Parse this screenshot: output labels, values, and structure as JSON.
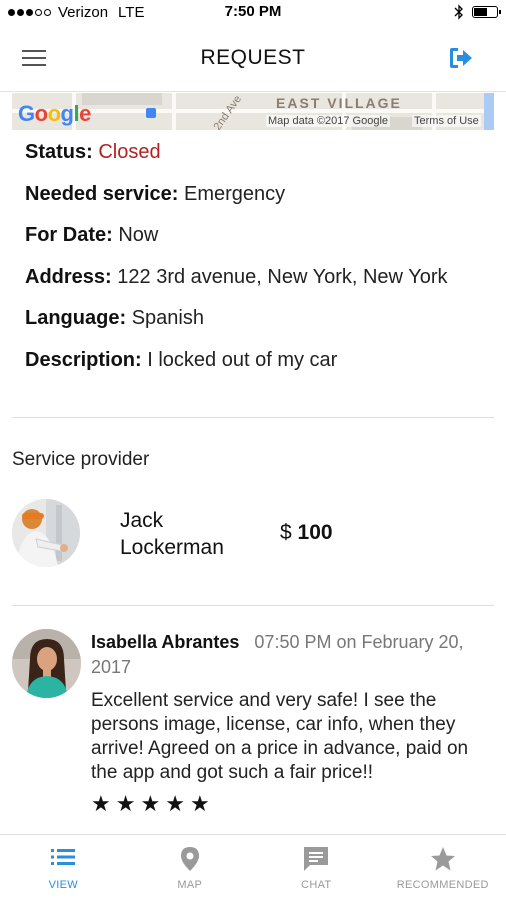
{
  "status_bar": {
    "carrier": "Verizon",
    "network": "LTE",
    "time": "7:50 PM",
    "battery_level": 0.6
  },
  "header": {
    "title": "REQUEST",
    "menu_icon": "hamburger-menu-icon",
    "action_icon": "sign-out-icon",
    "accent_color": "#2a8de0"
  },
  "map": {
    "logo": "Google",
    "area_label": "EAST VILLAGE",
    "street_label": "2nd Ave",
    "attribution": "Map data ©2017 Google",
    "terms_link": "Terms of Use"
  },
  "request": {
    "status_label": "Status:",
    "status_value": "Closed",
    "status_color": "#b22222",
    "service_label": "Needed service:",
    "service_value": "Emergency",
    "date_label": "For Date:",
    "date_value": "Now",
    "address_label": "Address:",
    "address_value": "122 3rd avenue, New York, New York",
    "language_label": "Language:",
    "language_value": "Spanish",
    "description_label": "Description:",
    "description_value": "I locked out of my car"
  },
  "provider": {
    "section_label": "Service provider",
    "first_name": "Jack",
    "last_name": "Lockerman",
    "currency": "$",
    "price": "100"
  },
  "review": {
    "name": "Isabella Abrantes",
    "time": "07:50 PM on February 20, 2017",
    "text": "Excellent service and very safe! I see the persons image, license, car info, when they arrive! Agreed on a price in advance, paid on the app and got such a fair price!!",
    "rating": 5,
    "star_glyph": "★"
  },
  "tabs": [
    {
      "label": "VIEW",
      "icon": "list-icon",
      "active": true
    },
    {
      "label": "MAP",
      "icon": "map-pin-icon",
      "active": false
    },
    {
      "label": "CHAT",
      "icon": "chat-icon",
      "active": false
    },
    {
      "label": "RECOMMENDED",
      "icon": "star-icon",
      "active": false
    }
  ]
}
